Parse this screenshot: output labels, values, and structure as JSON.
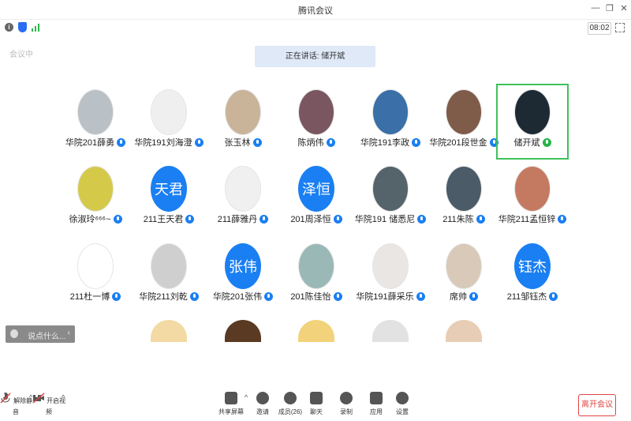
{
  "window": {
    "title": "腾讯会议"
  },
  "topbar": {
    "timer": "08:02",
    "watermark": "会议中"
  },
  "speaking": {
    "label": "正在讲话: 储开斌"
  },
  "participants": [
    {
      "name": "华院201薛勇",
      "mic": "blue"
    },
    {
      "name": "华院191刘海澄",
      "mic": "blue"
    },
    {
      "name": "张玉林",
      "mic": "blue"
    },
    {
      "name": "陈炳伟",
      "mic": "blue"
    },
    {
      "name": "华院191李政",
      "mic": "blue"
    },
    {
      "name": "华院201段世金",
      "mic": "blue"
    },
    {
      "name": "储开斌",
      "mic": "green",
      "active": true
    },
    {
      "name": "徐淑玲⁶⁶⁶~",
      "mic": "blue"
    },
    {
      "name": "211王天君",
      "mic": "blue",
      "avatar_text": "天君"
    },
    {
      "name": "211薛雅丹",
      "mic": "blue"
    },
    {
      "name": "201周泽恒",
      "mic": "blue",
      "avatar_text": "泽恒"
    },
    {
      "name": "华院191 储悉尼",
      "mic": "blue"
    },
    {
      "name": "211朱陈",
      "mic": "blue"
    },
    {
      "name": "华院211孟恒锌",
      "mic": "blue"
    },
    {
      "name": "211杜一博",
      "mic": "blue"
    },
    {
      "name": "华院211刘乾",
      "mic": "blue"
    },
    {
      "name": "华院201张伟",
      "mic": "blue",
      "avatar_text": "张伟"
    },
    {
      "name": "201陈佳怡",
      "mic": "blue"
    },
    {
      "name": "华院191薛采乐",
      "mic": "blue"
    },
    {
      "name": "席帅",
      "mic": "blue"
    },
    {
      "name": "211邹钰杰",
      "mic": "blue",
      "avatar_text": "钰杰"
    }
  ],
  "chat": {
    "placeholder": "说点什么..."
  },
  "toolbar": {
    "unmute": "解除静音",
    "video": "开启视频",
    "share": "共享屏幕",
    "invite": "邀请",
    "members": "成员(26)",
    "chat": "聊天",
    "record": "录制",
    "apps": "应用",
    "settings": "设置",
    "leave": "离开会议"
  },
  "colors": {
    "accent": "#1a7ff2",
    "speaking_bg": "#dfe9f7",
    "active_border": "#3fc15a",
    "leave": "#e04545"
  }
}
